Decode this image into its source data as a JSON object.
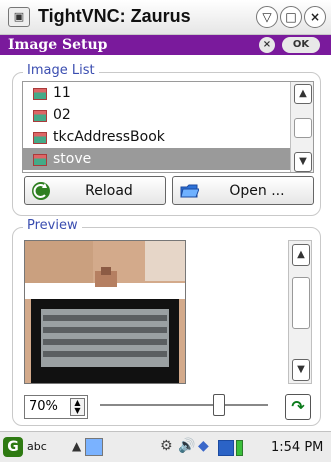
{
  "window": {
    "title": "TightVNC: Zaurus",
    "controls": [
      "▽",
      "□",
      "×"
    ]
  },
  "dialog": {
    "title": "Image Setup",
    "close_label": "×",
    "ok_label": "OK"
  },
  "image_list": {
    "legend": "Image List",
    "items": [
      {
        "name": "11",
        "selected": false
      },
      {
        "name": "02",
        "selected": false
      },
      {
        "name": "tkcAddressBook",
        "selected": false
      },
      {
        "name": "stove",
        "selected": true
      }
    ]
  },
  "buttons": {
    "reload": "Reload",
    "open": "Open ..."
  },
  "preview": {
    "legend": "Preview"
  },
  "zoom": {
    "value": "70%",
    "slider_fraction": 0.7
  },
  "taskbar": {
    "input_mode": "abc",
    "time": "1:54 PM"
  },
  "colors": {
    "dialog_bar": "#7a1a9c",
    "legend_text": "#3a4db0",
    "selected_row": "#9a9a9a"
  }
}
